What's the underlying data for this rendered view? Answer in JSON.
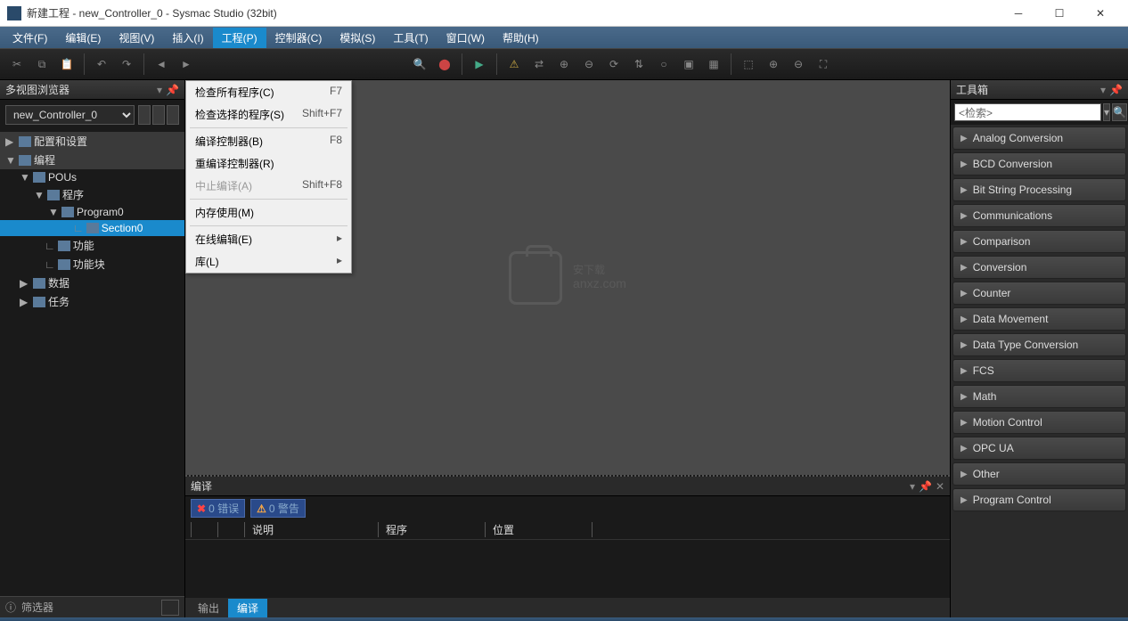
{
  "window": {
    "title": "新建工程 - new_Controller_0 - Sysmac Studio (32bit)"
  },
  "menu": {
    "items": [
      "文件(F)",
      "编辑(E)",
      "视图(V)",
      "插入(I)",
      "工程(P)",
      "控制器(C)",
      "模拟(S)",
      "工具(T)",
      "窗口(W)",
      "帮助(H)"
    ],
    "active_index": 4
  },
  "dropdown": {
    "items": [
      {
        "label": "检查所有程序(C)",
        "shortcut": "F7"
      },
      {
        "label": "检查选择的程序(S)",
        "shortcut": "Shift+F7"
      },
      {
        "divider": true
      },
      {
        "label": "编译控制器(B)",
        "shortcut": "F8"
      },
      {
        "label": "重编译控制器(R)",
        "shortcut": ""
      },
      {
        "label": "中止编译(A)",
        "shortcut": "Shift+F8",
        "disabled": true
      },
      {
        "divider": true
      },
      {
        "label": "内存使用(M)",
        "shortcut": ""
      },
      {
        "divider": true
      },
      {
        "label": "在线编辑(E)",
        "submenu": true
      },
      {
        "label": "库(L)",
        "submenu": true
      }
    ]
  },
  "sidebar_left": {
    "title": "多视图浏览器",
    "controller": "new_Controller_0",
    "tree": [
      {
        "label": "配置和设置",
        "indent": 0,
        "arrow": "▶",
        "bg": "#3a3a3a"
      },
      {
        "label": "编程",
        "indent": 0,
        "arrow": "▼",
        "bg": "#3a3a3a"
      },
      {
        "label": "POUs",
        "indent": 1,
        "arrow": "▼"
      },
      {
        "label": "程序",
        "indent": 2,
        "arrow": "▼"
      },
      {
        "label": "Program0",
        "indent": 3,
        "arrow": "▼"
      },
      {
        "label": "Section0",
        "indent": 4,
        "arrow": "",
        "prefix": "∟",
        "selected": true
      },
      {
        "label": "功能",
        "indent": 2,
        "arrow": "",
        "prefix": "∟"
      },
      {
        "label": "功能块",
        "indent": 2,
        "arrow": "",
        "prefix": "∟"
      },
      {
        "label": "数据",
        "indent": 1,
        "arrow": "▶"
      },
      {
        "label": "任务",
        "indent": 1,
        "arrow": "▶"
      }
    ],
    "filter": "筛选器"
  },
  "watermark": {
    "text": "安下载",
    "sub": "anxz.com"
  },
  "bottom": {
    "title": "编译",
    "errors": "0 错误",
    "warnings": "0 警告",
    "columns": [
      "",
      "",
      "说明",
      "程序",
      "位置",
      ""
    ],
    "tabs": [
      "输出",
      "编译"
    ],
    "active_tab": 1
  },
  "sidebar_right": {
    "title": "工具箱",
    "search_placeholder": "<检索>",
    "items": [
      "Analog Conversion",
      "BCD Conversion",
      "Bit String Processing",
      "Communications",
      "Comparison",
      "Conversion",
      "Counter",
      "Data Movement",
      "Data Type Conversion",
      "FCS",
      "Math",
      "Motion Control",
      "OPC UA",
      "Other",
      "Program Control"
    ]
  }
}
